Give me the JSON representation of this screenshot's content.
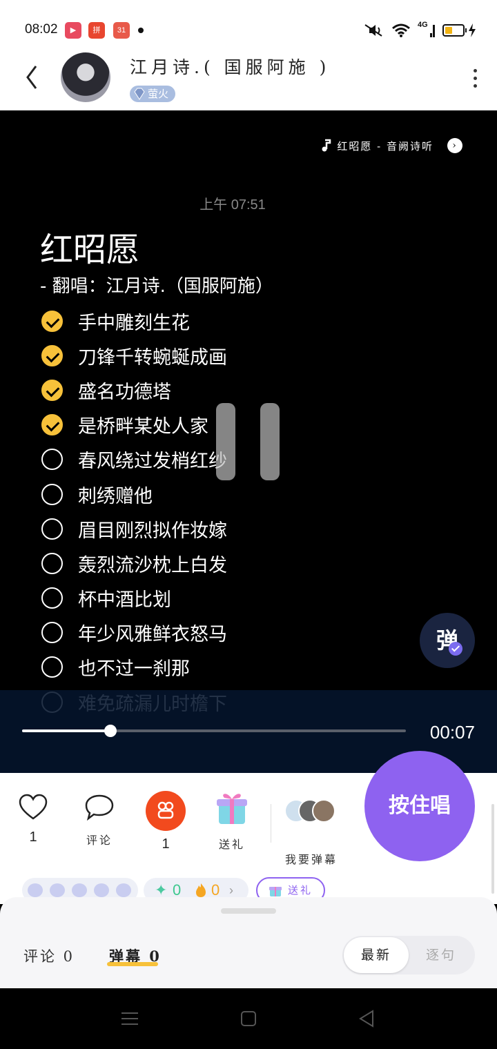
{
  "status_bar": {
    "time": "08:02",
    "apps": [
      {
        "icon": "video-app-icon",
        "text": "▶",
        "color": "#e84a5f"
      },
      {
        "icon": "shopping-app-icon",
        "text": "拼",
        "color": "#e8462f"
      },
      {
        "icon": "calendar-app-icon",
        "text": "31",
        "color": "#e85a4a"
      }
    ],
    "network": "4G"
  },
  "header": {
    "title": "江月诗.( 国服阿施 )",
    "badge": "萤火"
  },
  "player": {
    "song_link": "红昭愿 - 音阙诗听",
    "time_label": "上午 07:51",
    "song_title": "红昭愿",
    "subtitle": "- 翻唱：江月诗.（国服阿施）",
    "lyrics": [
      {
        "text": "手中雕刻生花",
        "done": true
      },
      {
        "text": "刀锋千转蜿蜒成画",
        "done": true
      },
      {
        "text": "盛名功德塔",
        "done": true
      },
      {
        "text": "是桥畔某处人家",
        "done": true
      },
      {
        "text": "春风绕过发梢红纱",
        "done": false
      },
      {
        "text": "刺绣赠他",
        "done": false
      },
      {
        "text": "眉目刚烈拟作妆嫁",
        "done": false
      },
      {
        "text": "轰烈流沙枕上白发",
        "done": false
      },
      {
        "text": "杯中酒比划",
        "done": false
      },
      {
        "text": "年少风雅鲜衣怒马",
        "done": false
      },
      {
        "text": "也不过一刹那",
        "done": false
      },
      {
        "text": "难免疏漏儿时檐下",
        "done": false
      }
    ],
    "danmu_button": "弹",
    "progress": 0.23,
    "elapsed": "00:07"
  },
  "actions": {
    "like_count": "1",
    "comment_label": "评论",
    "share_count": "1",
    "gift_label": "送礼",
    "danmu_label": "我要弹幕",
    "sing_button": "按住唱",
    "stat_diamond": "0",
    "stat_fire": "0",
    "gift_pill": "送礼"
  },
  "sheet": {
    "tab_comments": "评论 0",
    "tab_danmu": "弹幕 0",
    "sort_latest": "最新",
    "sort_line": "逐句"
  },
  "colors": {
    "accent": "#8e62f0",
    "check_yellow": "#f7c13a",
    "share_red": "#f24a1e"
  }
}
